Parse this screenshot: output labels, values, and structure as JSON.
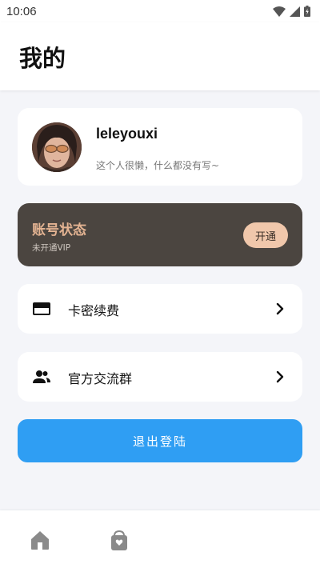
{
  "status_bar": {
    "time": "10:06"
  },
  "header": {
    "title": "我的"
  },
  "profile": {
    "username": "leleyouxi",
    "bio": "这个人很懒，什么都没有写~"
  },
  "vip": {
    "title": "账号状态",
    "subtitle": "未开通VIP",
    "button_label": "开通"
  },
  "menu": {
    "items": [
      {
        "label": "卡密续费",
        "icon": "credit-card-icon"
      },
      {
        "label": "官方交流群",
        "icon": "group-icon"
      }
    ]
  },
  "logout": {
    "label": "退出登陆"
  },
  "bottom_nav": {
    "items": [
      {
        "icon": "home-icon"
      },
      {
        "icon": "shopping-bag-icon"
      }
    ]
  },
  "colors": {
    "accent": "#2f9ef3",
    "vip_card": "#4b4540",
    "vip_title": "#e3b392",
    "vip_button": "#f0c7ab",
    "background": "#f4f5f9"
  }
}
